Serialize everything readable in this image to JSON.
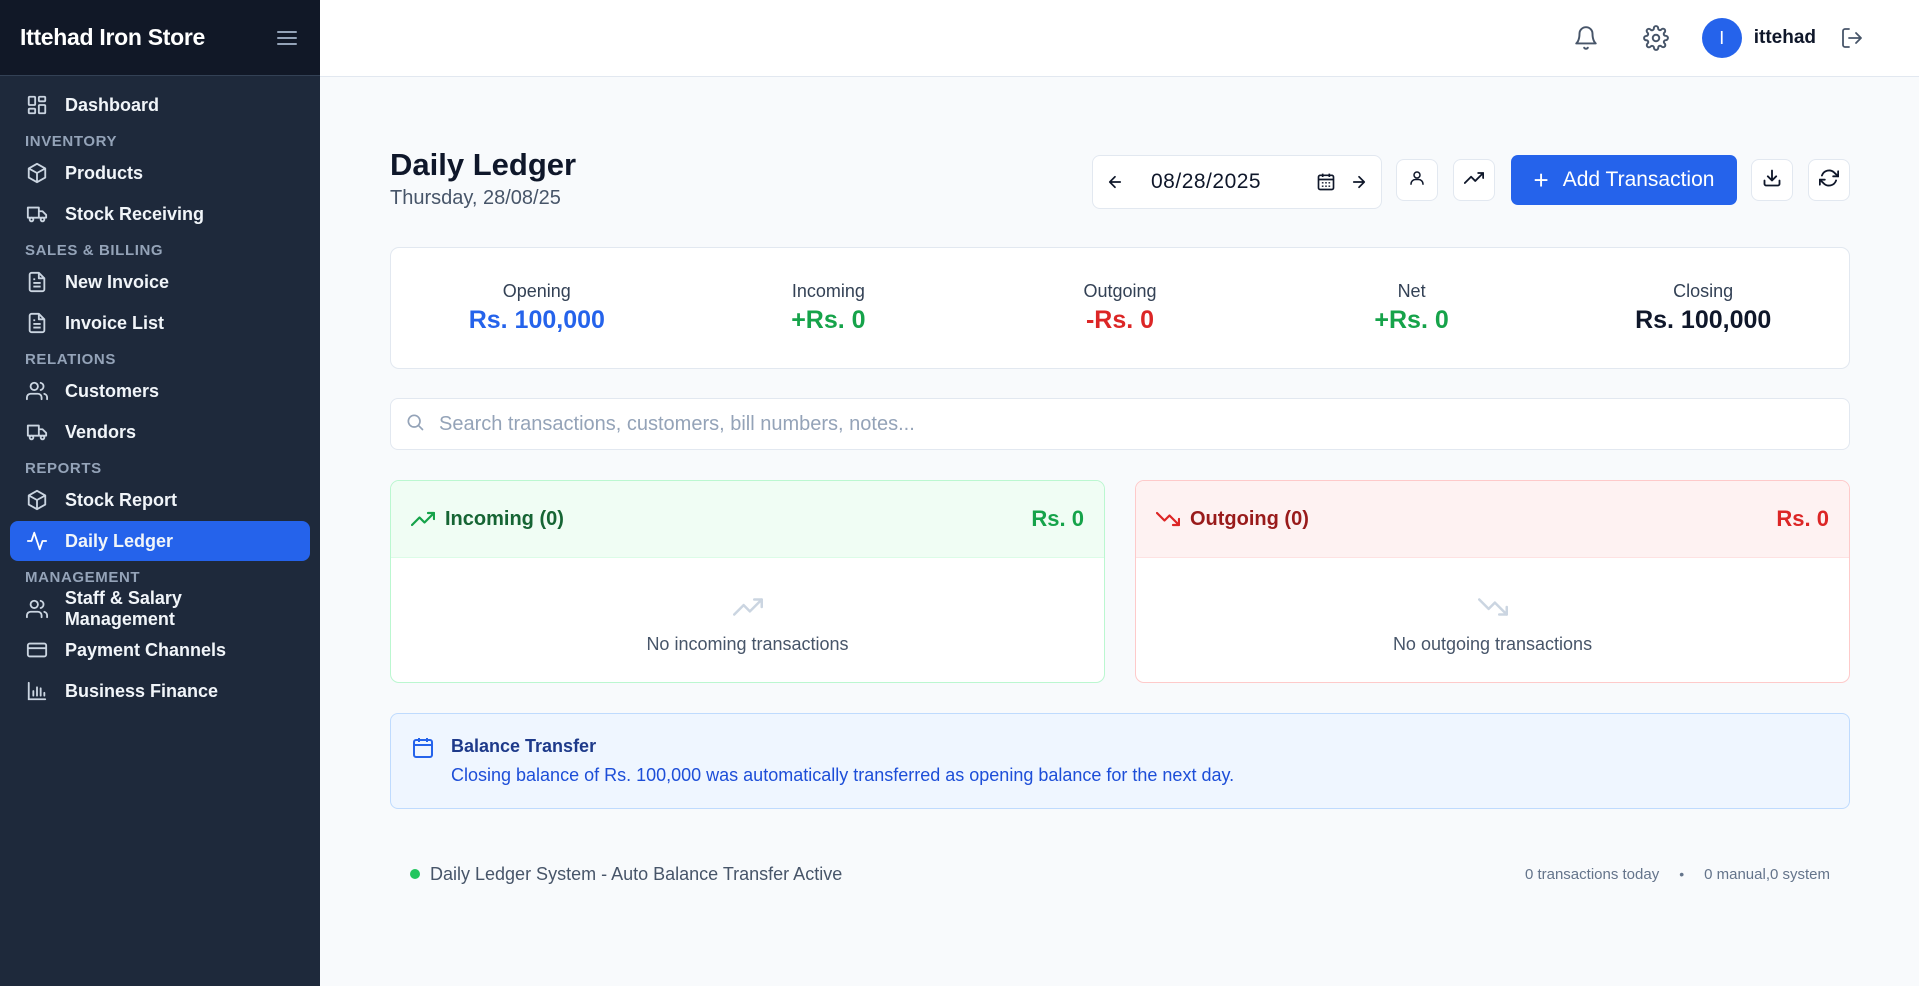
{
  "app": {
    "title": "Ittehad Iron Store"
  },
  "sidebar": {
    "dashboard": "Dashboard",
    "sections": {
      "inventory": "INVENTORY",
      "sales": "SALES & BILLING",
      "relations": "RELATIONS",
      "reports": "REPORTS",
      "management": "MANAGEMENT"
    },
    "items": {
      "products": "Products",
      "stock_receiving": "Stock Receiving",
      "new_invoice": "New Invoice",
      "invoice_list": "Invoice List",
      "customers": "Customers",
      "vendors": "Vendors",
      "stock_report": "Stock Report",
      "daily_ledger": "Daily Ledger",
      "staff_salary": "Staff & Salary Management",
      "payment_channels": "Payment Channels",
      "business_finance": "Business Finance"
    },
    "active": "daily_ledger"
  },
  "topbar": {
    "avatar_initial": "I",
    "username": "ittehad"
  },
  "page": {
    "title": "Daily Ledger",
    "subtitle": "Thursday, 28/08/25",
    "date_value": "08/28/2025",
    "add_button": "Add Transaction",
    "add_icon": "+"
  },
  "stats": {
    "opening": {
      "label": "Opening",
      "value": "Rs. 100,000",
      "color": "#2563eb"
    },
    "incoming": {
      "label": "Incoming",
      "value": "+Rs. 0",
      "color": "#16a34a"
    },
    "outgoing": {
      "label": "Outgoing",
      "value": "-Rs. 0",
      "color": "#dc2626"
    },
    "net": {
      "label": "Net",
      "value": "+Rs. 0",
      "color": "#16a34a"
    },
    "closing": {
      "label": "Closing",
      "value": "Rs. 100,000",
      "color": "#0f172a"
    }
  },
  "search": {
    "placeholder": "Search transactions, customers, bill numbers, notes...",
    "value": ""
  },
  "incoming_panel": {
    "title": "Incoming (0)",
    "amount": "Rs. 0",
    "empty": "No incoming transactions"
  },
  "outgoing_panel": {
    "title": "Outgoing (0)",
    "amount": "Rs. 0",
    "empty": "No outgoing transactions"
  },
  "transfer": {
    "title": "Balance Transfer",
    "text": "Closing balance of Rs. 100,000 was automatically transferred as opening balance for the next day."
  },
  "footer": {
    "status": "Daily Ledger System - Auto Balance Transfer Active",
    "count": "0 transactions today",
    "separator": "•",
    "breakdown": "0 manual,0 system"
  }
}
